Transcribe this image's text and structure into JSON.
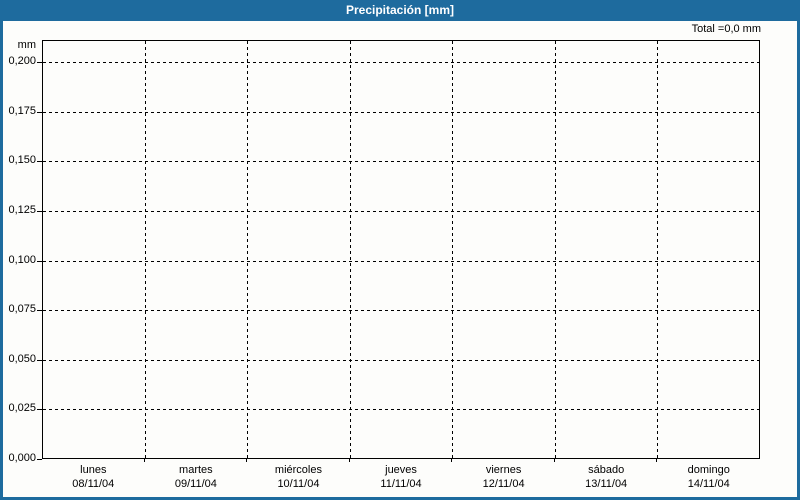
{
  "titlebar": {
    "title": "Precipitación [mm]"
  },
  "summary": {
    "total_label": "Total =0,0 mm"
  },
  "chart_data": {
    "type": "bar",
    "title": "Precipitación [mm]",
    "ylabel": "mm",
    "xlabel": "",
    "categories": [
      "lunes",
      "martes",
      "miércoles",
      "jueves",
      "viernes",
      "sábado",
      "domingo"
    ],
    "category_dates": [
      "08/11/04",
      "09/11/04",
      "10/11/04",
      "11/11/04",
      "12/11/04",
      "13/11/04",
      "14/11/04"
    ],
    "values": [
      0,
      0,
      0,
      0,
      0,
      0,
      0
    ],
    "total_label": "Total =0,0 mm",
    "ylim": [
      0,
      0.21
    ],
    "ytick_labels": [
      "0,200",
      "0,175",
      "0,150",
      "0,125",
      "0,100",
      "0,075",
      "0,050",
      "0,025",
      "0,000"
    ],
    "ytick_values": [
      0.2,
      0.175,
      0.15,
      0.125,
      0.1,
      0.075,
      0.05,
      0.025,
      0.0
    ],
    "decimal_separator": ",",
    "grid": "dashed",
    "legend_position": "none",
    "colors": {
      "header_bg": "#1e6b9e",
      "header_text": "#ffffff",
      "window_border": "#1e6b9e",
      "plot_background": "#fdfdfb",
      "axis": "#000000",
      "grid": "#000000",
      "text": "#000000"
    }
  }
}
